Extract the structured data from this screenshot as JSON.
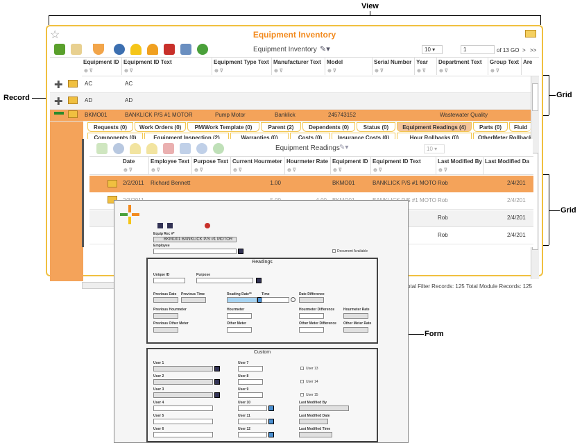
{
  "callouts": {
    "view": "View",
    "record": "Record",
    "grid1": "Grid",
    "grid2": "Grid",
    "form": "Form"
  },
  "view": {
    "title": "Equipment Inventory",
    "toolbar_title": "Equipment Inventory",
    "page_size": "10",
    "page_input": "1",
    "page_of": "of 13 GO",
    "nav_next": ">",
    "nav_last": ">>",
    "columns": [
      "Equipment ID",
      "Equipment ID Text",
      "Equipment Type Text",
      "Manufacturer Text",
      "Model",
      "Serial Number",
      "Year",
      "Department Text",
      "Group Text",
      "Are"
    ],
    "rows": [
      {
        "id": "AC",
        "id_text": "AC",
        "type": "",
        "mfr": "",
        "model": "",
        "serial": "",
        "year": "",
        "dept": "",
        "group": ""
      },
      {
        "id": "AD",
        "id_text": "AD",
        "type": "",
        "mfr": "",
        "model": "",
        "serial": "",
        "year": "",
        "dept": "",
        "group": ""
      },
      {
        "id": "BKMO01",
        "id_text": "BANKLICK P/S #1 MOTOR",
        "type": "Pump Motor",
        "mfr": "Banklick",
        "model": "245743152",
        "serial": "",
        "year": "",
        "dept": "Wastewater Quality",
        "group": ""
      }
    ],
    "tabs_row1": [
      "Requests (0)",
      "Work Orders (0)",
      "PM/Work Template (0)",
      "Parent (2)",
      "Dependents (0)",
      "Status (0)",
      "Equipment Readings (4)",
      "Parts (0)",
      "Fluid"
    ],
    "tabs_row2": [
      "Components (0)",
      "Equipment Inspection (2)",
      "Warranties (0)",
      "Costs (0)",
      "Insurance Costs (0)",
      "Hour Rollbacks (0)",
      "OtherMeter Rollbacks"
    ],
    "footer": "Total Filter Records: 125  Total Module Records: 125"
  },
  "subgrid": {
    "title": "Equipment Readings",
    "page_size": "10",
    "columns": [
      "Date",
      "Employee Text",
      "Purpose Text",
      "Current Hourmeter",
      "Hourmeter Rate",
      "Equipment ID",
      "Equipment ID Text",
      "Last Modified By",
      "Last Modified Da"
    ],
    "rows": [
      {
        "date": "2/2/2011",
        "emp": "Richard Bennett",
        "purpose": "",
        "cur": "1.00",
        "rate": "",
        "eqid": "BKMO01",
        "eqtext": "BANKLICK P/S #1 MOTOR",
        "by": "Rob",
        "modd": "2/4/201"
      },
      {
        "date": "2/3/2011",
        "emp": "",
        "purpose": "",
        "cur": "5.00",
        "rate": "4.00",
        "eqid": "BKMO01",
        "eqtext": "BANKLICK P/S #1 MOTOR",
        "by": "Rob",
        "modd": "2/4/201"
      },
      {
        "date": "",
        "emp": "",
        "purpose": "",
        "cur": "",
        "rate": "",
        "eqid": "",
        "eqtext": "#1 MOTOR",
        "by": "Rob",
        "modd": "2/4/201"
      },
      {
        "date": "",
        "emp": "",
        "purpose": "",
        "cur": "",
        "rate": "",
        "eqid": "",
        "eqtext": "#1 MOTOR",
        "by": "Rob",
        "modd": "2/4/201"
      }
    ]
  },
  "form": {
    "equip_rec_label": "Equip Rec #*",
    "equip_rec_value": "BKMO01 BANKLICK P/S #1 MOTOR",
    "employee_label": "Employee",
    "doc_available": "Document Available",
    "readings_title": "Readings",
    "unique_id": "Unique ID",
    "purpose": "Purpose",
    "prev_date": "Previous Date",
    "prev_time": "Previous Time",
    "reading_date": "Reading Date**",
    "time": "Time",
    "date_diff": "Date Difference",
    "prev_hour": "Previous Hourmeter",
    "hourmeter": "Hourmeter",
    "hour_diff": "Hourmeter Difference",
    "hour_rate": "Hourmeter Rate",
    "prev_other": "Previous Other Meter",
    "other_meter": "Other Meter",
    "other_diff": "Other Meter Difference",
    "other_rate": "Other Meter Rate",
    "custom_title": "Custom",
    "user1": "User 1",
    "user2": "User 2",
    "user3": "User 3",
    "user4": "User 4",
    "user5": "User 5",
    "user6": "User 6",
    "user7": "User 7",
    "user8": "User 8",
    "user9": "User 9",
    "user10": "User 10",
    "user11": "User 11",
    "user12": "User 12",
    "user13": "User 13",
    "user14": "User 14",
    "user15": "User 15",
    "last_mod_by": "Last Modified By",
    "last_mod_date": "Last Modified Date",
    "last_mod_time": "Last Modified Time"
  }
}
